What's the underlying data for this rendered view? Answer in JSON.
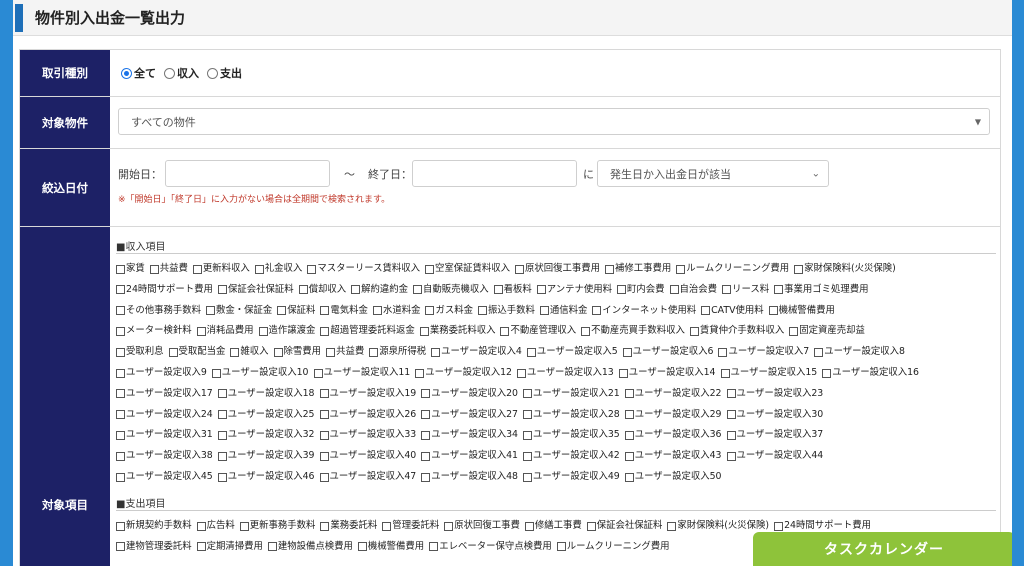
{
  "page_title": "物件別入出金一覧出力",
  "transaction_type": {
    "label": "取引種別",
    "options": [
      {
        "label": "全て",
        "selected": true
      },
      {
        "label": "収入",
        "selected": false
      },
      {
        "label": "支出",
        "selected": false
      }
    ]
  },
  "property": {
    "label": "対象物件",
    "selected": "すべての物件",
    "arrow": "▼"
  },
  "date_filter": {
    "label": "絞込日付",
    "start_label": "開始日：",
    "tilde": "〜",
    "end_label": "終了日：",
    "ni": "に",
    "date_type_selected": "発生日か入出金日が該当",
    "note": "※「開始日」「終了日」に入力がない場合は全期間で検索されます。"
  },
  "items": {
    "label": "対象項目",
    "income_heading": "■収入項目",
    "income_lines": [
      [
        "家賃",
        "共益費",
        "更新料収入",
        "礼金収入",
        "マスターリース賃料収入",
        "空室保証賃料収入",
        "原状回復工事費用",
        "補修工事費用",
        "ルームクリーニング費用",
        "家財保険料(火災保険)"
      ],
      [
        "24時間サポート費用",
        "保証会社保証料",
        "償却収入",
        "解約違約金",
        "自動販売機収入",
        "看板料",
        "アンテナ使用料",
        "町内会費",
        "自治会費",
        "リース料",
        "事業用ゴミ処理費用"
      ],
      [
        "その他事務手数料",
        "敷金・保証金",
        "保証料",
        "電気料金",
        "水道料金",
        "ガス料金",
        "振込手数料",
        "通信料金",
        "インターネット使用料",
        "CATV使用料",
        "機械警備費用"
      ],
      [
        "メーター検針料",
        "消耗品費用",
        "造作譲渡金",
        "超過管理委託料返金",
        "業務委託料収入",
        "不動産管理収入",
        "不動産売買手数料収入",
        "賃貸仲介手数料収入",
        "固定資産売却益"
      ],
      [
        "受取利息",
        "受取配当金",
        "雑収入",
        "除雪費用",
        "共益費",
        "源泉所得税",
        "ユーザー設定収入4",
        "ユーザー設定収入5",
        "ユーザー設定収入6",
        "ユーザー設定収入7",
        "ユーザー設定収入8"
      ],
      [
        "ユーザー設定収入9",
        "ユーザー設定収入10",
        "ユーザー設定収入11",
        "ユーザー設定収入12",
        "ユーザー設定収入13",
        "ユーザー設定収入14",
        "ユーザー設定収入15",
        "ユーザー設定収入16"
      ],
      [
        "ユーザー設定収入17",
        "ユーザー設定収入18",
        "ユーザー設定収入19",
        "ユーザー設定収入20",
        "ユーザー設定収入21",
        "ユーザー設定収入22",
        "ユーザー設定収入23"
      ],
      [
        "ユーザー設定収入24",
        "ユーザー設定収入25",
        "ユーザー設定収入26",
        "ユーザー設定収入27",
        "ユーザー設定収入28",
        "ユーザー設定収入29",
        "ユーザー設定収入30"
      ],
      [
        "ユーザー設定収入31",
        "ユーザー設定収入32",
        "ユーザー設定収入33",
        "ユーザー設定収入34",
        "ユーザー設定収入35",
        "ユーザー設定収入36",
        "ユーザー設定収入37"
      ],
      [
        "ユーザー設定収入38",
        "ユーザー設定収入39",
        "ユーザー設定収入40",
        "ユーザー設定収入41",
        "ユーザー設定収入42",
        "ユーザー設定収入43",
        "ユーザー設定収入44"
      ],
      [
        "ユーザー設定収入45",
        "ユーザー設定収入46",
        "ユーザー設定収入47",
        "ユーザー設定収入48",
        "ユーザー設定収入49",
        "ユーザー設定収入50"
      ]
    ],
    "expense_heading": "■支出項目",
    "expense_lines": [
      [
        "新規契約手数料",
        "広告料",
        "更新事務手数料",
        "業務委託料",
        "管理委託料",
        "原状回復工事費",
        "修繕工事費",
        "保証会社保証料",
        "家財保険料(火災保険)",
        "24時間サポート費用"
      ],
      [
        "建物管理委託料",
        "定期清掃費用",
        "建物設備点検費用",
        "機械警備費用",
        "エレベーター保守点検費用",
        "ルームクリーニング費用"
      ]
    ]
  },
  "task_calendar_button": "タスクカレンダー"
}
